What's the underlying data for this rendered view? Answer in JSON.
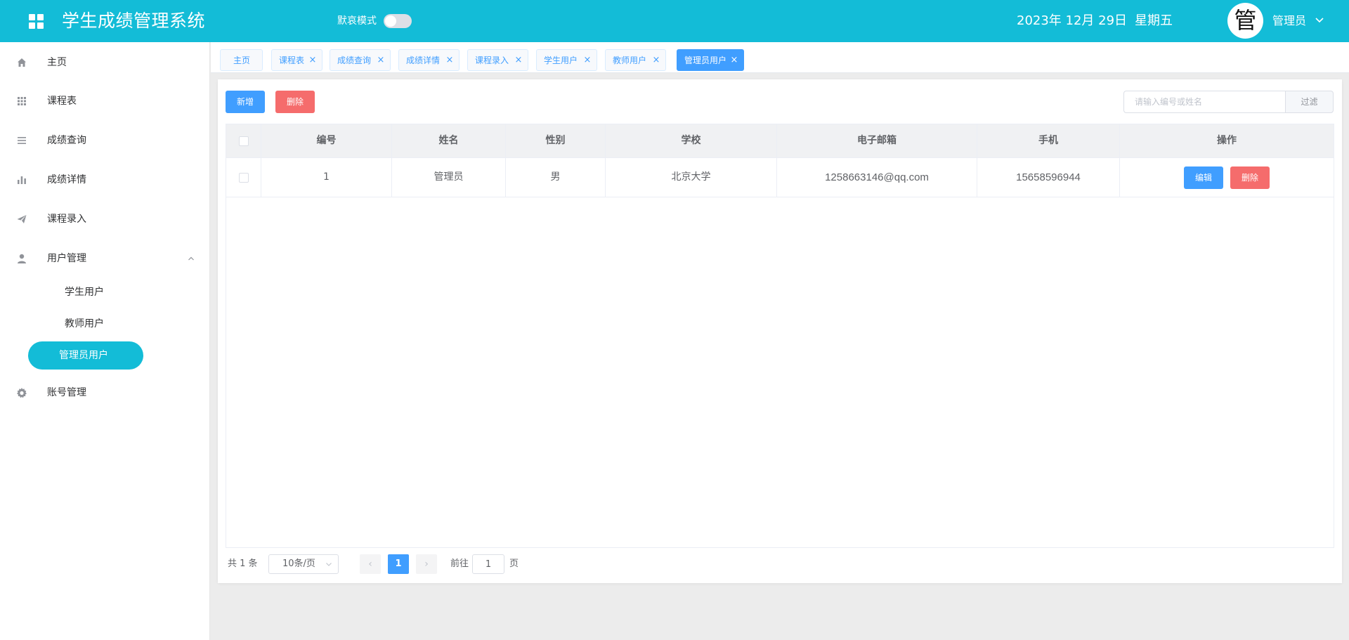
{
  "header": {
    "title": "学生成绩管理系统",
    "mode_label": "默哀模式",
    "mode_on": false,
    "date": "2023年 12月 29日",
    "weekday": "星期五",
    "avatar_char": "管",
    "user_name": "管理员",
    "bg_color": "#13bcd7"
  },
  "sidebar": {
    "items": [
      {
        "label": "主页",
        "icon": "home-icon"
      },
      {
        "label": "课程表",
        "icon": "grid-icon"
      },
      {
        "label": "成绩查询",
        "icon": "list-icon"
      },
      {
        "label": "成绩详情",
        "icon": "bar-chart-icon"
      },
      {
        "label": "课程录入",
        "icon": "send-icon"
      },
      {
        "label": "用户管理",
        "icon": "user-icon",
        "expanded": true
      },
      {
        "label": "账号管理",
        "icon": "gear-icon"
      }
    ],
    "sub_items": [
      {
        "label": "学生用户"
      },
      {
        "label": "教师用户"
      },
      {
        "label": "管理员用户",
        "active": true
      }
    ]
  },
  "tabs": [
    {
      "label": "主页",
      "closable": false
    },
    {
      "label": "课程表",
      "closable": true
    },
    {
      "label": "成绩查询",
      "closable": true
    },
    {
      "label": "成绩详情",
      "closable": true
    },
    {
      "label": "课程录入",
      "closable": true
    },
    {
      "label": "学生用户",
      "closable": true
    },
    {
      "label": "教师用户",
      "closable": true
    },
    {
      "label": "管理员用户",
      "closable": true,
      "active": true
    }
  ],
  "toolbar": {
    "add_label": "新增",
    "delete_label": "删除",
    "search_placeholder": "请输入编号或姓名",
    "filter_label": "过滤"
  },
  "table": {
    "columns": [
      "编号",
      "姓名",
      "性别",
      "学校",
      "电子邮箱",
      "手机",
      "操作"
    ],
    "rows": [
      {
        "id": "1",
        "name": "管理员",
        "gender": "男",
        "school": "北京大学",
        "email": "1258663146@qq.com",
        "phone": "15658596944",
        "edit_label": "编辑",
        "delete_label": "删除"
      }
    ]
  },
  "pagination": {
    "total_text": "共 1 条",
    "page_size": "10条/页",
    "current_page": "1",
    "goto_label": "前往",
    "goto_value": "1",
    "page_suffix": "页"
  }
}
